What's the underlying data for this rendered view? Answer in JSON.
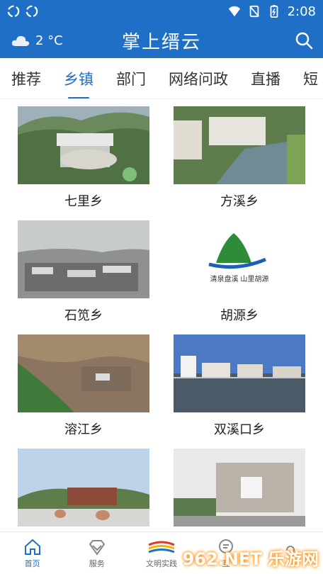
{
  "status": {
    "time": "2:08"
  },
  "header": {
    "weather_temp": "2 °C",
    "title": "掌上缙云"
  },
  "tabs": [
    {
      "label": "推荐",
      "active": false
    },
    {
      "label": "乡镇",
      "active": true
    },
    {
      "label": "部门",
      "active": false
    },
    {
      "label": "网络问政",
      "active": false
    },
    {
      "label": "直播",
      "active": false
    },
    {
      "label": "短",
      "active": false
    }
  ],
  "grid": [
    {
      "label": "七里乡"
    },
    {
      "label": "方溪乡"
    },
    {
      "label": "石笕乡"
    },
    {
      "label": "胡源乡",
      "logo_text": "清泉盘溪  山里胡源"
    },
    {
      "label": "溶江乡"
    },
    {
      "label": "双溪口乡"
    },
    {
      "label": ""
    },
    {
      "label": ""
    }
  ],
  "nav": {
    "items": [
      {
        "label": "首页",
        "active": true,
        "icon": "home-icon"
      },
      {
        "label": "服务",
        "active": false,
        "icon": "diamond-icon"
      },
      {
        "label": "文明实践",
        "active": false,
        "icon": "civilization-logo"
      },
      {
        "label": "互",
        "active": false,
        "icon": "chat-icon"
      },
      {
        "label": "",
        "active": false,
        "icon": "more-icon"
      }
    ]
  },
  "watermark": "962.NET 乐游网",
  "colors": {
    "primary": "#1f6fc7"
  }
}
